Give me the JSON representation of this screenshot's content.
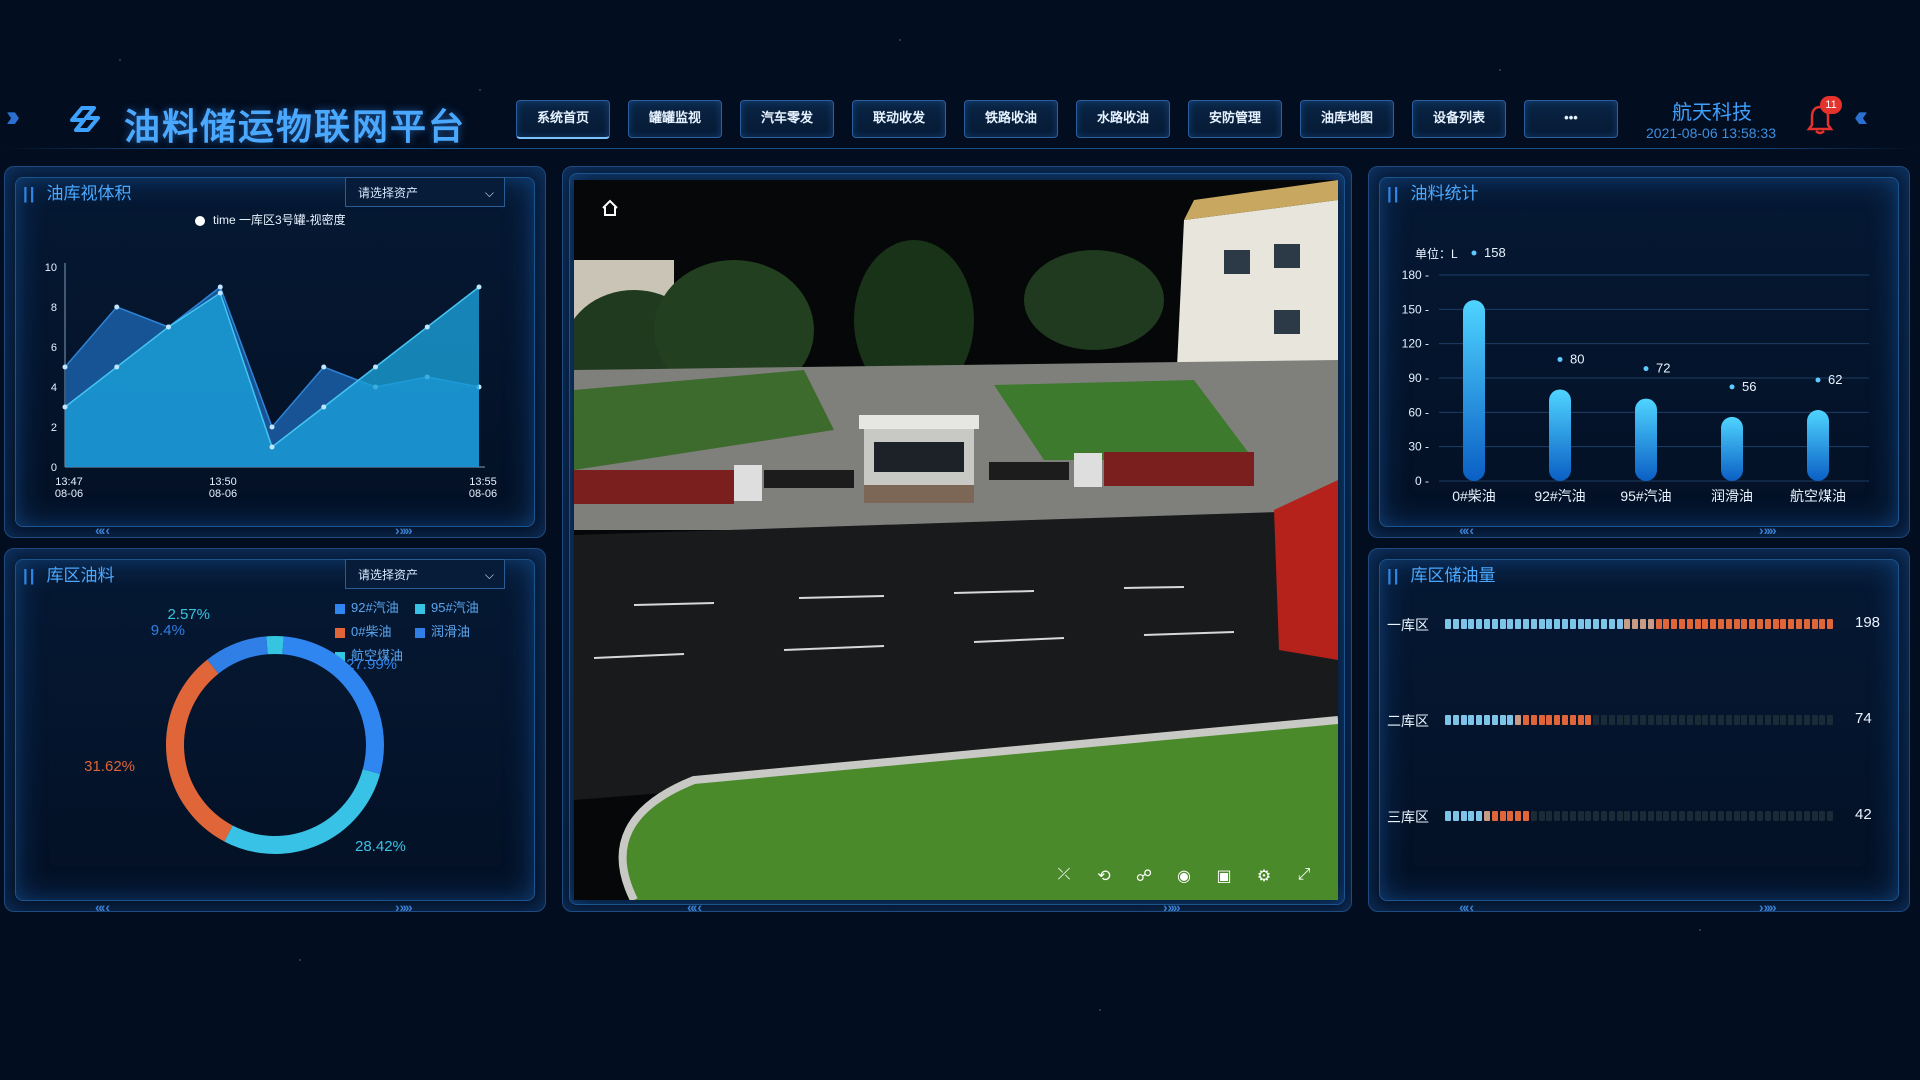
{
  "header": {
    "title": "油料储运物联网平台",
    "brand": "航天科技",
    "datetime": "2021-08-06 13:58:33",
    "notification_count": "11",
    "nav": [
      {
        "label": "系统首页",
        "active": true
      },
      {
        "label": "罐罐监视"
      },
      {
        "label": "汽车零发"
      },
      {
        "label": "联动收发"
      },
      {
        "label": "铁路收油"
      },
      {
        "label": "水路收油"
      },
      {
        "label": "安防管理"
      },
      {
        "label": "油库地图"
      },
      {
        "label": "设备列表"
      },
      {
        "label": "•••"
      }
    ]
  },
  "panels": {
    "tank_volume": {
      "title": "油库视体积",
      "select_placeholder": "请选择资产",
      "legend": "time 一库区3号罐-视密度"
    },
    "zone_oil": {
      "title": "库区油料",
      "select_placeholder": "请选择资产"
    },
    "oil_stats": {
      "title": "油料统计",
      "unit_label": "单位：L"
    },
    "zone_storage": {
      "title": "库区储油量"
    }
  },
  "chart_data": [
    {
      "type": "area",
      "title": "",
      "legend": [
        "time 一库区3号罐-视密度"
      ],
      "ylim": [
        0,
        10
      ],
      "yticks": [
        "0",
        "2",
        "4",
        "6",
        "8",
        "10"
      ],
      "xticks": [
        "13:47\n08-06",
        "13:50\n08-06",
        "13:55\n08-06"
      ],
      "series": [
        {
          "values": [
            5,
            8,
            7,
            9,
            2,
            5,
            4,
            4.5,
            4
          ]
        },
        {
          "values": [
            3,
            5,
            7,
            8.7,
            1,
            3,
            5,
            7,
            9
          ]
        }
      ]
    },
    {
      "type": "pie",
      "legend": [
        "92#汽油",
        "95#汽油",
        "0#柴油",
        "润滑油",
        "航空煤油"
      ],
      "slices": [
        {
          "label": "92#汽油",
          "value": 27.99,
          "text": "27.99%",
          "color": "#2f86f0"
        },
        {
          "label": "95#汽油",
          "value": 28.42,
          "text": "28.42%",
          "color": "#38c3e6"
        },
        {
          "label": "0#柴油",
          "value": 31.62,
          "text": "31.62%",
          "color": "#e0663a"
        },
        {
          "label": "润滑油",
          "value": 9.4,
          "text": "9.4%",
          "color": "#2f7fe6"
        },
        {
          "label": "航空煤油",
          "value": 2.57,
          "text": "2.57%",
          "color": "#36c5e0"
        }
      ]
    },
    {
      "type": "bar",
      "title": "",
      "ylabel": "单位：L",
      "ylim": [
        0,
        180
      ],
      "yticks": [
        "0",
        "30",
        "60",
        "90",
        "120",
        "150",
        "180"
      ],
      "categories": [
        "0#柴油",
        "92#汽油",
        "95#汽油",
        "润滑油",
        "航空煤油"
      ],
      "values": [
        158,
        80,
        72,
        56,
        62
      ]
    },
    {
      "type": "bar",
      "orientation": "horizontal",
      "categories": [
        "一库区",
        "二库区",
        "三库区"
      ],
      "values": [
        198,
        74,
        42
      ],
      "max": 198
    }
  ],
  "colors": {
    "accent": "#4aa8ff",
    "orange": "#e0663a",
    "cyan": "#38c3e6",
    "bar_blue": "#1e88e5"
  },
  "icons": [
    "home-icon",
    "share-icon",
    "rotate-icon",
    "walk-icon",
    "globe-icon",
    "camera-icon",
    "gear-icon",
    "fullscreen-icon",
    "bell-icon"
  ]
}
